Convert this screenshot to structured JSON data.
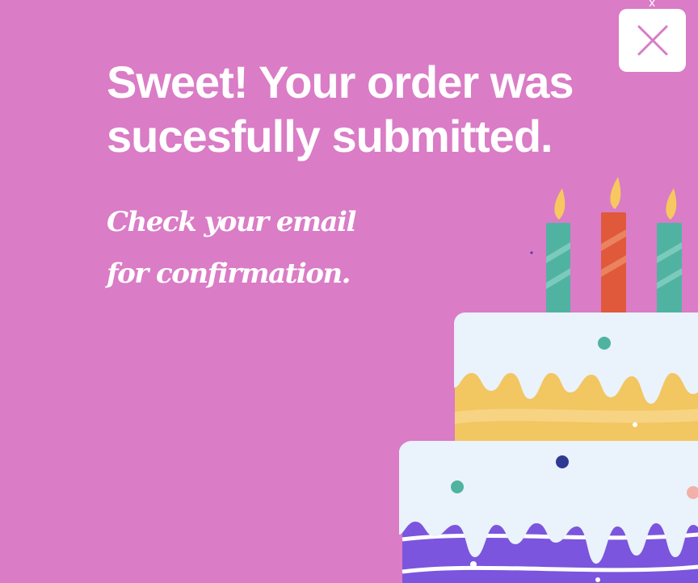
{
  "modal": {
    "corner_mark": "x",
    "headline": "Sweet! Your order was sucesfully submitted.",
    "subline": "Check your email for confirmation.",
    "close_icon": "close-icon",
    "illustration_icon": "birthday-cake-icon"
  },
  "colors": {
    "background": "#da7cc6",
    "close_button_bg": "#ffffff",
    "close_icon": "#d67dc6",
    "text": "#ffffff",
    "frosting": "#eaf2fb",
    "sponge_yellow": "#f2c660",
    "sponge_purple": "#7b55dd",
    "candle_teal": "#50b3a2",
    "candle_red": "#e0593a",
    "flame": "#f6c85f"
  }
}
